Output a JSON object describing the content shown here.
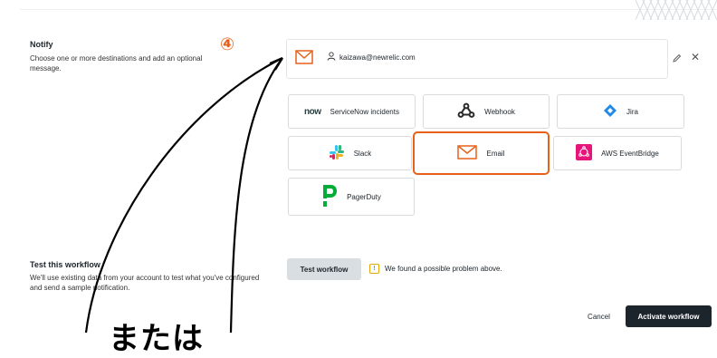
{
  "notify": {
    "title": "Notify",
    "description": "Choose one or more destinations and add an optional message.",
    "recipient": "kaizawa@newrelic.com"
  },
  "destinations": [
    {
      "label": "ServiceNow incidents",
      "logo_text": "now",
      "icon": "servicenow-logo"
    },
    {
      "label": "Webhook",
      "icon": "webhook-icon"
    },
    {
      "label": "Jira",
      "icon": "jira-icon"
    },
    {
      "label": "Slack",
      "icon": "slack-icon"
    },
    {
      "label": "Email",
      "icon": "email-icon"
    },
    {
      "label": "AWS EventBridge",
      "icon": "aws-eventbridge-icon"
    },
    {
      "label": "PagerDuty",
      "icon": "pagerduty-icon"
    }
  ],
  "test": {
    "title": "Test this workflow",
    "description": "We'll use existing data from your account to test what you've configured and send a sample notification.",
    "button": "Test workflow",
    "warning": "We found a possible problem above.",
    "warning_glyph": "!"
  },
  "footer": {
    "cancel": "Cancel",
    "activate": "Activate workflow"
  },
  "annotation": {
    "step_marker": "④",
    "caption": "または"
  },
  "colors": {
    "highlight": "#e8611a",
    "primary_button": "#1d252c",
    "secondary_button": "#d9dee2",
    "email_icon": "#e8611a",
    "jira": "#1f8ae8",
    "pagerduty": "#06ac38",
    "aws_eventbridge": "#e7157b",
    "warning": "#e0a800"
  }
}
